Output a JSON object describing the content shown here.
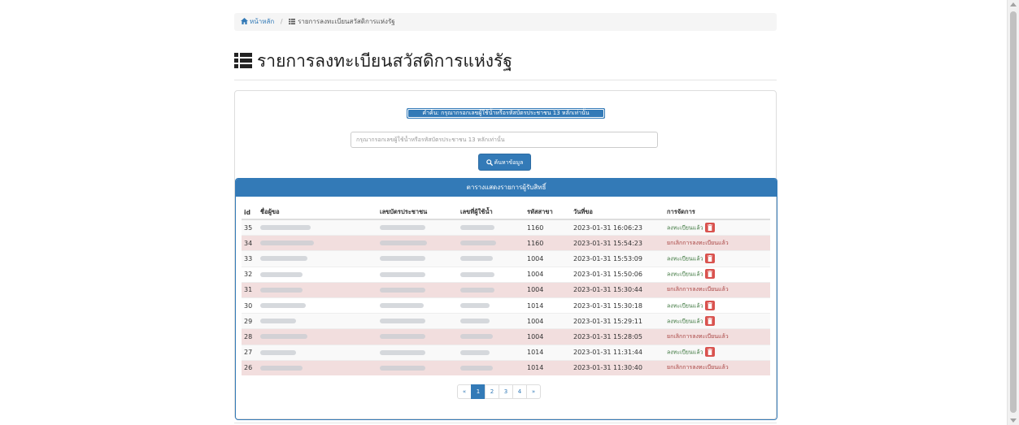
{
  "breadcrumb": {
    "home_label": "หน้าหลัก",
    "current_label": "รายการลงทะเบียนสวัสดิการแห่งรัฐ"
  },
  "page": {
    "title": "รายการลงทะเบียนสวัสดิการแห่งรัฐ"
  },
  "search": {
    "notice": "คำค้น: กรุณากรอกเลขผู้ใช้น้ำหรือรหัสบัตรประชาชน 13 หลักเท่านั้น",
    "placeholder": "กรุณากรอกเลขผู้ใช้น้ำหรือรหัสบัตรประชาชน 13 หลักเท่านั้น",
    "button_label": "ค้นหาข้อมูล"
  },
  "table": {
    "heading": "ตารางแสดงรายการผู้รับสิทธิ์",
    "columns": {
      "id": "id",
      "name": "ชื่อผู้ขอ",
      "citizen_id": "เลขบัตรประชาชน",
      "water_user_no": "เลขที่ผู้ใช้น้ำ",
      "branch_code": "รหัสสาขา",
      "request_date": "วันที่ขอ",
      "action": "การจัดการ"
    },
    "rows": [
      {
        "id": "35",
        "branch_code": "1160",
        "request_date": "2023-01-31 16:06:23",
        "status": "ลงทะเบียนแล้ว",
        "state": "registered"
      },
      {
        "id": "34",
        "branch_code": "1160",
        "request_date": "2023-01-31 15:54:23",
        "status": "ยกเลิกการลงทะเบียนแล้ว",
        "state": "cancelled"
      },
      {
        "id": "33",
        "branch_code": "1004",
        "request_date": "2023-01-31 15:53:09",
        "status": "ลงทะเบียนแล้ว",
        "state": "registered"
      },
      {
        "id": "32",
        "branch_code": "1004",
        "request_date": "2023-01-31 15:50:06",
        "status": "ลงทะเบียนแล้ว",
        "state": "registered"
      },
      {
        "id": "31",
        "branch_code": "1004",
        "request_date": "2023-01-31 15:30:44",
        "status": "ยกเลิกการลงทะเบียนแล้ว",
        "state": "cancelled"
      },
      {
        "id": "30",
        "branch_code": "1014",
        "request_date": "2023-01-31 15:30:18",
        "status": "ลงทะเบียนแล้ว",
        "state": "registered"
      },
      {
        "id": "29",
        "branch_code": "1004",
        "request_date": "2023-01-31 15:29:11",
        "status": "ลงทะเบียนแล้ว",
        "state": "registered"
      },
      {
        "id": "28",
        "branch_code": "1004",
        "request_date": "2023-01-31 15:28:05",
        "status": "ยกเลิกการลงทะเบียนแล้ว",
        "state": "cancelled"
      },
      {
        "id": "27",
        "branch_code": "1014",
        "request_date": "2023-01-31 11:31:44",
        "status": "ลงทะเบียนแล้ว",
        "state": "registered"
      },
      {
        "id": "26",
        "branch_code": "1014",
        "request_date": "2023-01-31 11:30:40",
        "status": "ยกเลิกการลงทะเบียนแล้ว",
        "state": "cancelled"
      }
    ]
  },
  "pagination": {
    "prev": "«",
    "pages": [
      "1",
      "2",
      "3",
      "4"
    ],
    "next": "»",
    "active_page": "1"
  },
  "icons": {
    "home": "home-icon",
    "list": "list-icon",
    "search": "search-icon",
    "delete": "trash-icon"
  },
  "colors": {
    "primary": "#337ab7",
    "cancelled_row": "#f2dede",
    "success_text": "#3c763d",
    "danger_text": "#a94442",
    "danger_button": "#d9534f"
  }
}
